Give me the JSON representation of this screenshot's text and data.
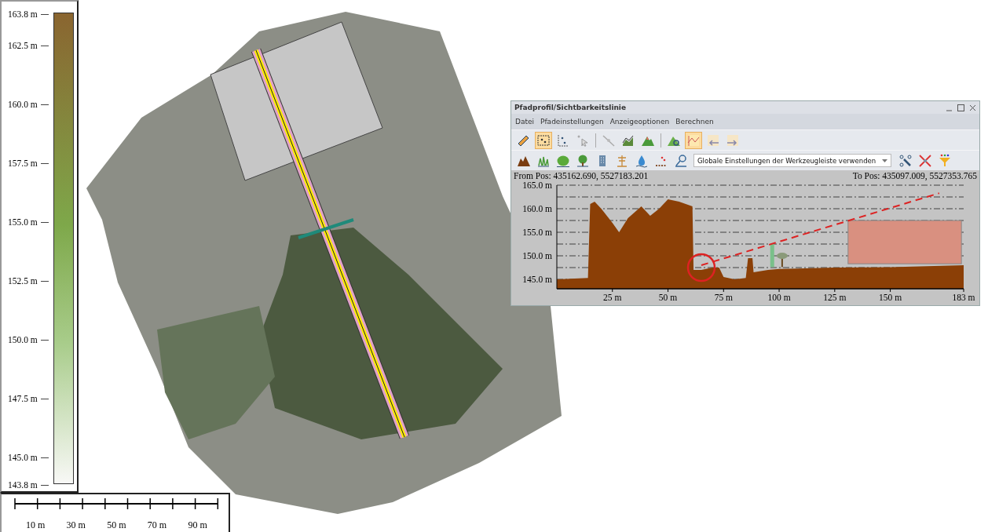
{
  "legend": {
    "labels": [
      "163.8 m",
      "162.5 m",
      "160.0 m",
      "157.5 m",
      "155.0 m",
      "152.5 m",
      "150.0 m",
      "147.5 m",
      "145.0 m",
      "143.8 m"
    ]
  },
  "scale_bar": {
    "labels": [
      "10 m",
      "30 m",
      "50 m",
      "70 m",
      "90 m"
    ]
  },
  "profile_window": {
    "title": "Pfadprofil/Sichtbarkeitslinie",
    "menu": [
      "Datei",
      "Pfadeinstellungen",
      "Anzeigeoptionen",
      "Berechnen"
    ],
    "toolbar_1": [
      {
        "selected": false
      },
      {
        "selected": true
      },
      {
        "selected": false
      },
      {
        "selected": false
      },
      {
        "selected": false
      },
      {
        "selected": false
      },
      {
        "selected": false
      },
      {
        "selected": false
      },
      {
        "selected": true
      },
      {
        "selected": false
      },
      {
        "selected": false
      }
    ],
    "toolbar_2": [
      {
        "selected": false
      },
      {
        "selected": false
      },
      {
        "selected": false
      },
      {
        "selected": false
      },
      {
        "selected": false
      },
      {
        "selected": false
      },
      {
        "selected": false
      },
      {
        "selected": false
      },
      {
        "selected": false
      }
    ],
    "dropdown": {
      "value": "Globale Einstellungen der Werkzeugleiste verwenden"
    },
    "from_pos": "From Pos: 435162.690, 5527183.201",
    "to_pos": "To Pos: 435097.009, 5527353.765",
    "chart_data": {
      "type": "area",
      "x": [
        0,
        14,
        15,
        17,
        20,
        25,
        28,
        32,
        38,
        42,
        46,
        50,
        55,
        61,
        61.5,
        65,
        70,
        73,
        75,
        80,
        85,
        86,
        88,
        88.5,
        95,
        100,
        125,
        150,
        183
      ],
      "grid": true,
      "series": [
        {
          "color": "#8b3f06",
          "values": [
            145,
            145.3,
            161,
            161.5,
            160,
            157,
            155,
            158,
            160.5,
            158.5,
            160,
            162,
            161.5,
            160.5,
            147,
            147,
            147.5,
            147.5,
            145.5,
            145,
            145.3,
            149.5,
            149.5,
            146.5,
            147,
            147.2,
            147.5,
            147.6,
            148
          ]
        }
      ],
      "xlim": [
        0,
        183
      ],
      "ylim": [
        143,
        165
      ],
      "xticks": [
        {
          "value": 25,
          "label": "25 m"
        },
        {
          "value": 50,
          "label": "50 m"
        },
        {
          "value": 75,
          "label": "75 m"
        },
        {
          "value": 100,
          "label": "100 m"
        },
        {
          "value": 125,
          "label": "125 m"
        },
        {
          "value": 150,
          "label": "150 m"
        },
        {
          "value": 183,
          "label": "183 m"
        }
      ],
      "yticks": [
        {
          "value": 145,
          "label": "145.0 m"
        },
        {
          "value": 150,
          "label": "150.0 m"
        },
        {
          "value": 155,
          "label": "155.0 m"
        },
        {
          "value": 160,
          "label": "160.0 m"
        },
        {
          "value": 165,
          "label": "165.0 m"
        }
      ]
    }
  }
}
